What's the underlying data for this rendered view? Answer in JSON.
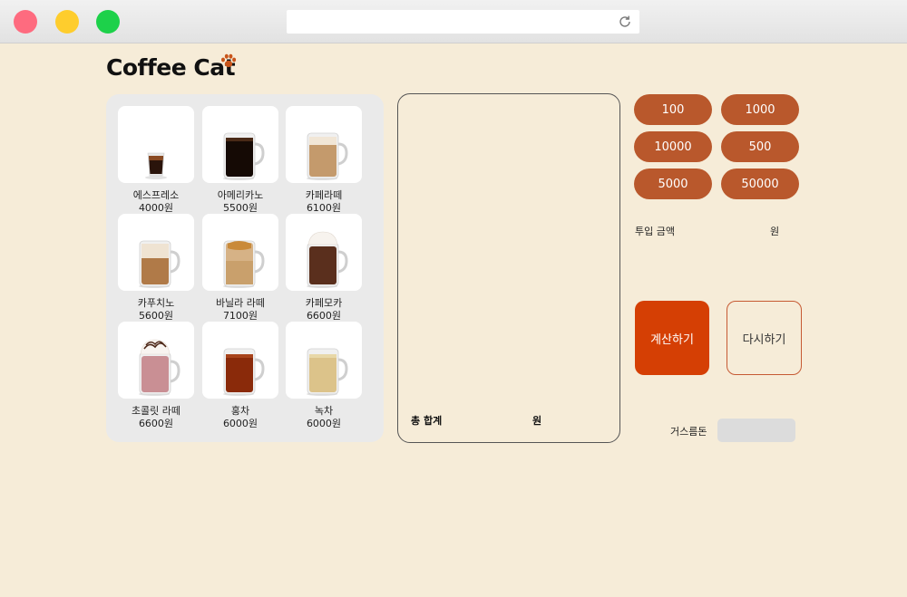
{
  "app": {
    "title": "Coffee Cat"
  },
  "menu": {
    "items": [
      {
        "name": "에스프레소",
        "price": "4000원",
        "drink": "espresso"
      },
      {
        "name": "아메리카노",
        "price": "5500원",
        "drink": "americano"
      },
      {
        "name": "카페라떼",
        "price": "6100원",
        "drink": "latte"
      },
      {
        "name": "카푸치노",
        "price": "5600원",
        "drink": "cappuccino"
      },
      {
        "name": "바닐라 라떼",
        "price": "7100원",
        "drink": "vanilla-latte"
      },
      {
        "name": "카페모카",
        "price": "6600원",
        "drink": "mocha"
      },
      {
        "name": "초콜릿 라떼",
        "price": "6600원",
        "drink": "chocolate-latte"
      },
      {
        "name": "홍차",
        "price": "6000원",
        "drink": "black-tea"
      },
      {
        "name": "녹차",
        "price": "6000원",
        "drink": "green-tea"
      }
    ]
  },
  "cart": {
    "total_label": "총 합계",
    "total_unit": "원"
  },
  "money": {
    "buttons": [
      "100",
      "1000",
      "10000",
      "500",
      "5000",
      "50000"
    ]
  },
  "inserted": {
    "label": "투입 금액",
    "unit": "원"
  },
  "actions": {
    "calculate": "계산하기",
    "reset": "다시하기"
  },
  "change": {
    "label": "거스름돈",
    "value": ""
  },
  "colors": {
    "background": "#f6ecd8",
    "money_button": "#b9582c",
    "calculate_button": "#d53f04",
    "panel": "#eaeaea"
  }
}
